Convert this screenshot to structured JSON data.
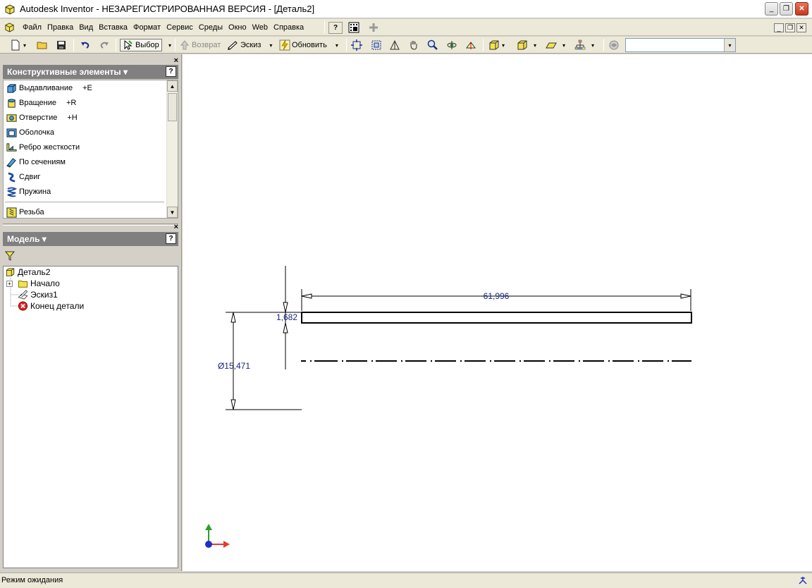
{
  "window": {
    "title": "Autodesk Inventor  - НЕЗАРЕГИСТРИРОВАННАЯ ВЕРСИЯ - [Деталь2]",
    "minimize": "_",
    "restore": "❐",
    "close": "✕"
  },
  "menu": {
    "items": [
      "Файл",
      "Правка",
      "Вид",
      "Вставка",
      "Формат",
      "Сервис",
      "Среды",
      "Окно",
      "Web",
      "Справка"
    ],
    "help_button": "?",
    "doc_minimize": "_",
    "doc_restore": "❐",
    "doc_close": "✕"
  },
  "toolbar": {
    "select_label": "Выбор",
    "return_label": "Возврат",
    "sketch_label": "Эскиз",
    "update_label": "Обновить",
    "dropdown": "▾",
    "combo_value": ""
  },
  "features_panel": {
    "title": "Конструктивные элементы ▾",
    "help": "?",
    "close": "×",
    "items": [
      {
        "label": "Выдавливание",
        "shortcut": "+E",
        "icon": "extrude-icon"
      },
      {
        "label": "Вращение",
        "shortcut": "+R",
        "icon": "revolve-icon"
      },
      {
        "label": "Отверстие",
        "shortcut": "+H",
        "icon": "hole-icon"
      },
      {
        "label": "Оболочка",
        "shortcut": "",
        "icon": "shell-icon"
      },
      {
        "label": "Ребро жесткости",
        "shortcut": "",
        "icon": "rib-icon"
      },
      {
        "label": "По сечениям",
        "shortcut": "",
        "icon": "loft-icon"
      },
      {
        "label": "Сдвиг",
        "shortcut": "",
        "icon": "sweep-icon"
      },
      {
        "label": "Пружина",
        "shortcut": "",
        "icon": "coil-icon"
      },
      {
        "label": "Резьба",
        "shortcut": "",
        "icon": "thread-icon"
      }
    ],
    "scroll_up": "▲",
    "scroll_down": "▼"
  },
  "model_panel": {
    "title": "Модель ▾",
    "help": "?",
    "close": "×",
    "tree": {
      "root": "Деталь2",
      "origin": "Начало",
      "sketch": "Эскиз1",
      "end": "Конец детали",
      "expander": "+"
    }
  },
  "drawing": {
    "dim_length": "61,996",
    "dim_thickness": "1,682",
    "dim_diameter": "Ø15,471"
  },
  "colors": {
    "dimension": "#1a237e",
    "axis_x": "#e53935",
    "axis_y": "#2e9e2e",
    "axis_z": "#1e30c8"
  },
  "status": {
    "text": "Режим ожидания"
  }
}
